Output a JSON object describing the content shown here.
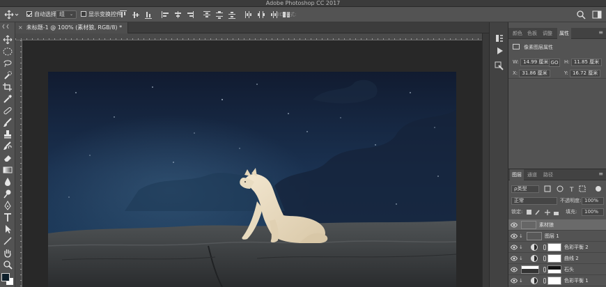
{
  "app": {
    "title": "Adobe Photoshop CC 2017"
  },
  "options_bar": {
    "auto_select_label": "自动选择:",
    "auto_select_checked": true,
    "auto_select_value": "组",
    "show_transform_label": "显示变换控件",
    "show_transform_checked": false,
    "mode_3d_label": "3D 模式:",
    "icons": [
      "move-tool-icon",
      "align-top-icon",
      "align-vcenter-icon",
      "align-bottom-icon",
      "align-left-icon",
      "align-hcenter-icon",
      "align-right-icon",
      "distribute-icons",
      "search-icon",
      "workspace-icon"
    ]
  },
  "document": {
    "tab_close": "×",
    "tab_title": "未标题-1 @ 100% (素材狼, RGB/8) *"
  },
  "tools": [
    "move",
    "marquee",
    "lasso",
    "quick-select",
    "crop",
    "eyedropper",
    "healing",
    "brush",
    "clone-stamp",
    "history-brush",
    "eraser",
    "gradient",
    "blur",
    "dodge",
    "pen",
    "type",
    "path-select",
    "line",
    "hand",
    "zoom"
  ],
  "colors": {
    "foreground": "#0e1f2a",
    "background": "#ffffff",
    "sky_top": "#121d33",
    "sky_mid": "#1b3455",
    "rock": "#3f4142"
  },
  "properties_panel": {
    "tabs": [
      "颜色",
      "色板",
      "调整",
      "属性"
    ],
    "active_tab": "属性",
    "menu_icon": "≡",
    "layer_type": "像素图层属性",
    "w_label": "W:",
    "w_value": "14.99 厘米",
    "link_glyph": "GO",
    "h_label": "H:",
    "h_value": "11.85 厘米",
    "x_label": "X:",
    "x_value": "31.86 厘米",
    "y_label": "Y:",
    "y_value": "16.72 厘米"
  },
  "layers_panel": {
    "tabs": [
      "图层",
      "通道",
      "路径"
    ],
    "active_tab": "图层",
    "menu_icon": "≡",
    "filter_value": "ρ类型",
    "blend_mode": "正常",
    "opacity_label": "不透明度:",
    "opacity_value": "100%",
    "lock_label": "锁定:",
    "fill_label": "填充:",
    "fill_value": "100%",
    "layers": [
      {
        "name": "素材狼",
        "kind": "pixel",
        "selected": true
      },
      {
        "name": "图层 1",
        "kind": "pixel-clipped",
        "selected": false
      },
      {
        "name": "色彩平衡 2",
        "kind": "adjustment",
        "selected": false
      },
      {
        "name": "曲线 2",
        "kind": "adjustment",
        "selected": false
      },
      {
        "name": "石头",
        "kind": "pixel-masked",
        "selected": false
      },
      {
        "name": "色彩平衡 1",
        "kind": "adjustment",
        "selected": false
      }
    ]
  }
}
